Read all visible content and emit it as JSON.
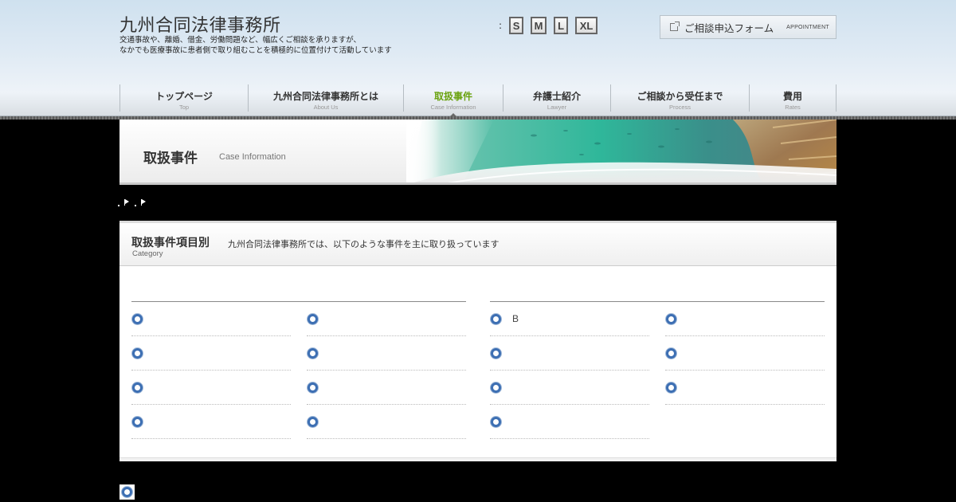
{
  "site": {
    "title": "九州合同法律事務所",
    "desc_line1": "交通事故や、離婚、借金、労働問題など、幅広くご相談を承りますが、",
    "desc_line2": "なかでも医療事故に患者側で取り組むことを積極的に位置付けて活動しています"
  },
  "font_size": {
    "colon": ":",
    "options": [
      "S",
      "M",
      "L",
      "XL"
    ]
  },
  "appointment": {
    "label": "ご相談申込フォーム",
    "sub": "APPOINTMENT"
  },
  "nav": [
    {
      "jp": "トップページ",
      "en": "Top",
      "active": false
    },
    {
      "jp": "九州合同法律事務所とは",
      "en": "About Us",
      "active": false
    },
    {
      "jp": "取扱事件",
      "en": "Case Information",
      "active": true
    },
    {
      "jp": "弁護士紹介",
      "en": "Lawyer",
      "active": false
    },
    {
      "jp": "ご相談から受任まで",
      "en": "Process",
      "active": false
    },
    {
      "jp": "費用",
      "en": "Rates",
      "active": false
    }
  ],
  "banner": {
    "title": "取扱事件",
    "sub": "Case Information"
  },
  "category": {
    "title": "取扱事件項目別",
    "en": "Category",
    "desc": "九州合同法律事務所では、以下のような事件を主に取り扱っています",
    "group1": {
      "col1": [
        "",
        "",
        "",
        ""
      ],
      "col2": [
        "",
        "",
        "",
        ""
      ]
    },
    "group2": {
      "col1": [
        "B",
        "",
        "",
        ""
      ],
      "col2": [
        "",
        "",
        ""
      ]
    }
  },
  "colors": {
    "accent_green": "#6aa20f",
    "ring_blue": "#3d6fb3"
  }
}
